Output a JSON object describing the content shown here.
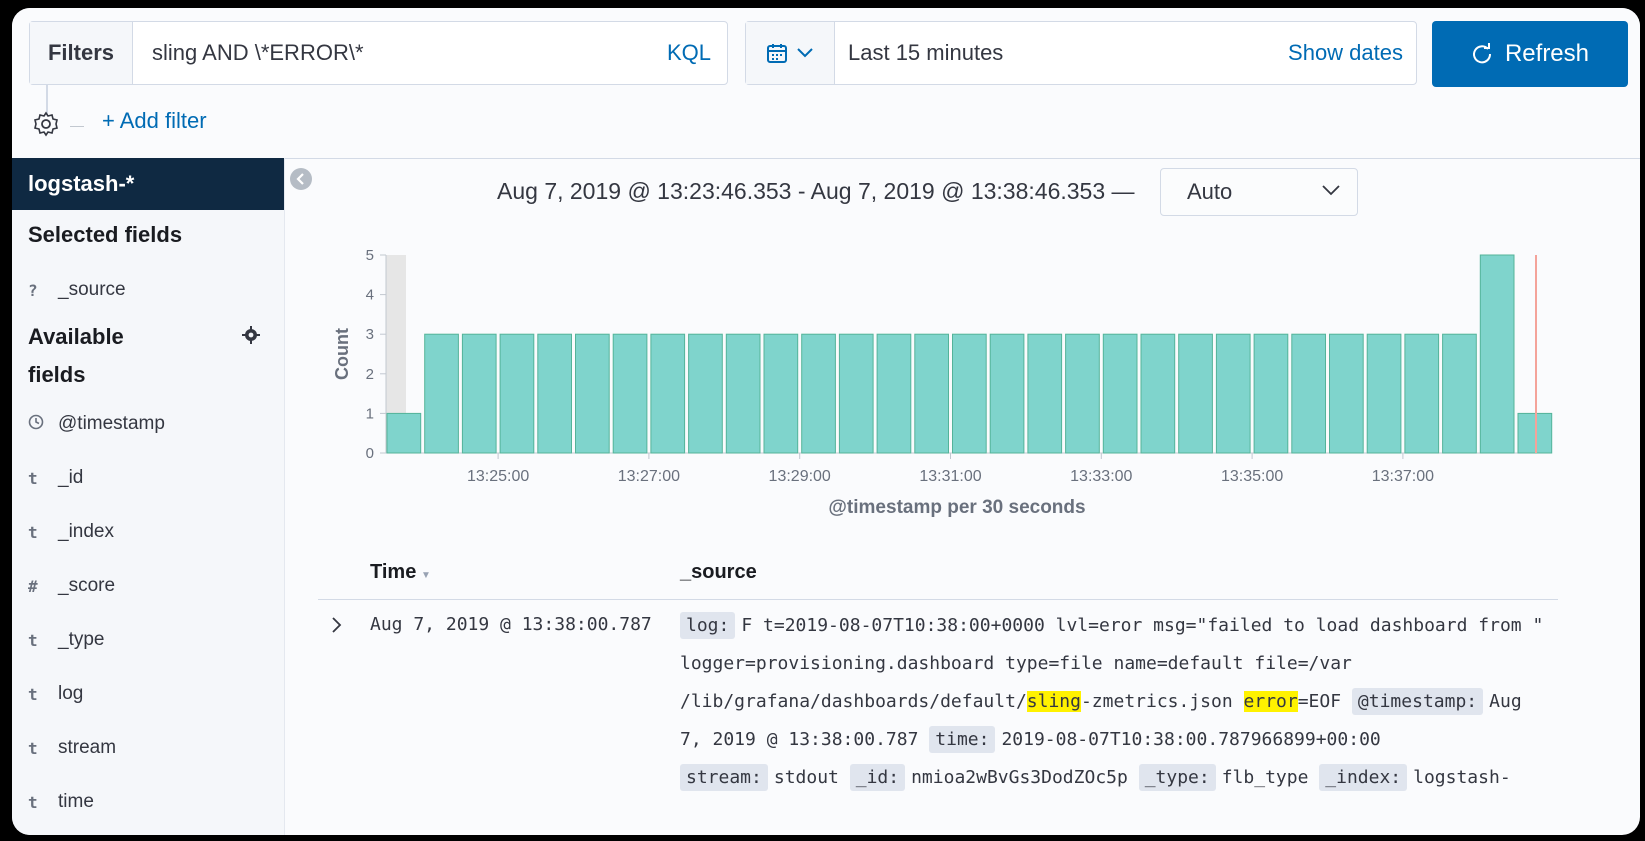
{
  "query_bar": {
    "filters_label": "Filters",
    "query": "sling AND \\*ERROR\\*",
    "language": "KQL",
    "date_range": "Last 15 minutes",
    "show_dates": "Show dates",
    "refresh": "Refresh"
  },
  "filter_bar": {
    "add_filter": "+ Add filter"
  },
  "sidebar": {
    "index_pattern": "logstash-*",
    "selected_title": "Selected fields",
    "selected_fields": [
      {
        "type": "?",
        "name": "_source"
      }
    ],
    "available_title_line1": "Available",
    "available_title_line2": "fields",
    "available_fields": [
      {
        "type": "clock",
        "name": "@timestamp"
      },
      {
        "type": "t",
        "name": "_id"
      },
      {
        "type": "t",
        "name": "_index"
      },
      {
        "type": "#",
        "name": "_score"
      },
      {
        "type": "t",
        "name": "_type"
      },
      {
        "type": "t",
        "name": "log"
      },
      {
        "type": "t",
        "name": "stream"
      },
      {
        "type": "t",
        "name": "time"
      }
    ]
  },
  "histogram": {
    "time_summary": "Aug 7, 2019 @ 13:23:46.353 - Aug 7, 2019 @ 13:38:46.353 —",
    "interval": "Auto"
  },
  "chart_data": {
    "type": "bar",
    "title": "",
    "xlabel": "@timestamp per 30 seconds",
    "ylabel": "Count",
    "ylim": [
      0,
      5
    ],
    "yticks": [
      0,
      1,
      2,
      3,
      4,
      5
    ],
    "xtick_labels": [
      "13:25:00",
      "13:27:00",
      "13:29:00",
      "13:31:00",
      "13:33:00",
      "13:35:00",
      "13:37:00"
    ],
    "categories": [
      "13:23:30",
      "13:24:00",
      "13:24:30",
      "13:25:00",
      "13:25:30",
      "13:26:00",
      "13:26:30",
      "13:27:00",
      "13:27:30",
      "13:28:00",
      "13:28:30",
      "13:29:00",
      "13:29:30",
      "13:30:00",
      "13:30:30",
      "13:31:00",
      "13:31:30",
      "13:32:00",
      "13:32:30",
      "13:33:00",
      "13:33:30",
      "13:34:00",
      "13:34:30",
      "13:35:00",
      "13:35:30",
      "13:36:00",
      "13:36:30",
      "13:37:00",
      "13:37:30",
      "13:38:00",
      "13:38:30"
    ],
    "values": [
      1,
      3,
      3,
      3,
      3,
      3,
      3,
      3,
      3,
      3,
      3,
      3,
      3,
      3,
      3,
      3,
      3,
      3,
      3,
      3,
      3,
      3,
      3,
      3,
      3,
      3,
      3,
      3,
      3,
      5,
      1
    ],
    "grid": false,
    "colors": {
      "bar_fill": "#7fd4cc",
      "bar_stroke": "#54b399",
      "out_of_range": "#e6e6e6",
      "now_marker": "#f4a39a"
    }
  },
  "doc_table": {
    "col_time": "Time",
    "col_source": "_source",
    "rows": [
      {
        "time": "Aug 7, 2019 @ 13:38:00.787",
        "f_log": "log:",
        "v_log_1": "F t=2019-08-07T10:38:00+0000 lvl=eror msg=\"failed to load dashboard from \" logger=provisioning.dashboard type=file name=default file=/var /lib/grafana/dashboards/default/",
        "v_log_hl1": "sling",
        "v_log_2": "-zmetrics.json ",
        "v_log_hl2": "error",
        "v_log_3": "=EOF",
        "f_ts": "@timestamp:",
        "v_ts": "Aug 7, 2019 @ 13:38:00.787",
        "f_time": "time:",
        "v_time": "2019-08-07T10:38:00.787966899+00:00",
        "f_stream": "stream:",
        "v_stream": "stdout",
        "f_id": "_id:",
        "v_id": "nmioa2wBvGs3DodZOc5p",
        "f_type": "_type:",
        "v_type": "flb_type",
        "f_index": "_index:",
        "v_index": "logstash-"
      }
    ]
  }
}
